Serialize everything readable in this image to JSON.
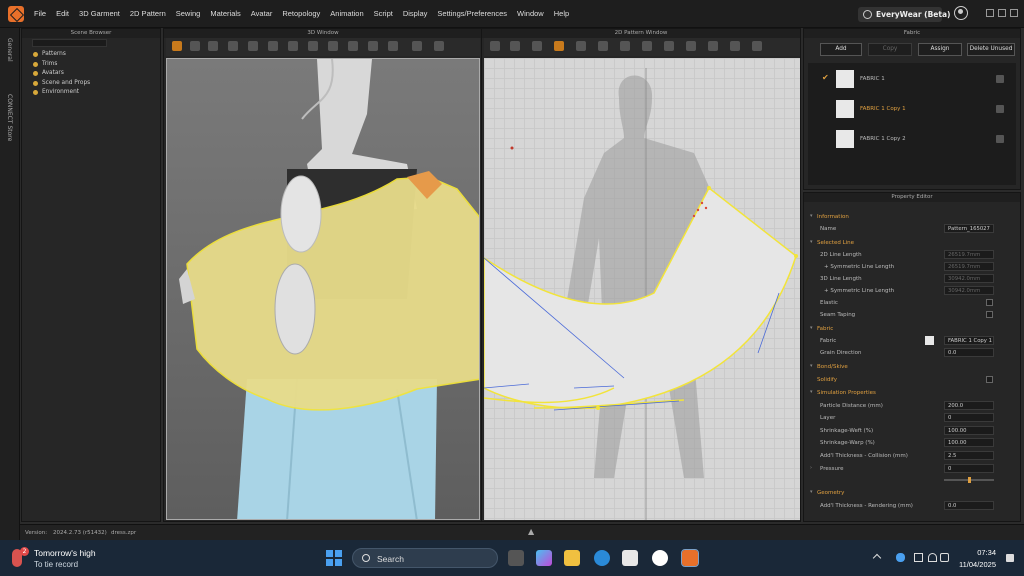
{
  "menubar": {
    "items": [
      "File",
      "Edit",
      "3D Garment",
      "2D Pattern",
      "Sewing",
      "Materials",
      "Avatar",
      "Retopology",
      "Animation",
      "Script",
      "Display",
      "Settings/Preferences",
      "Window",
      "Help"
    ],
    "brand": "EveryWear (Beta)"
  },
  "leftstrip": {
    "tabs": [
      "General",
      "CONNECT Store"
    ]
  },
  "scene_browser": {
    "title": "Scene Browser",
    "items": [
      "Patterns",
      "Trims",
      "Avatars",
      "Scene and Props",
      "Environment"
    ]
  },
  "window3d": {
    "title": "3D Window"
  },
  "window2d": {
    "title": "2D Pattern Window"
  },
  "fabric": {
    "title": "Fabric",
    "buttons": {
      "add": "Add",
      "copy": "Copy",
      "assign": "Assign",
      "delete_unused": "Delete Unused"
    },
    "items": [
      {
        "name": "FABRIC 1",
        "checked": true
      },
      {
        "name": "FABRIC 1 Copy 1",
        "selected": true
      },
      {
        "name": "FABRIC 1 Copy 2"
      }
    ]
  },
  "property_editor": {
    "title": "Property Editor",
    "information": "Information",
    "name_label": "Name",
    "name_value": "Pattern_165027",
    "selected_line": "Selected Line",
    "len2d_label": "2D Line Length",
    "len2d_value": "26519.7mm",
    "sym2d_label": "+ Symmetric Line Length",
    "sym2d_value": "26519.7mm",
    "len3d_label": "3D Line Length",
    "len3d_value": "30942.0mm",
    "sym3d_label": "+ Symmetric Line Length",
    "sym3d_value": "30942.0mm",
    "elastic": "Elastic",
    "seam_taping": "Seam Taping",
    "fabric_section": "Fabric",
    "fabric_label": "Fabric",
    "fabric_value": "FABRIC 1 Copy 1",
    "grain_label": "Grain Direction",
    "grain_value": "0.0",
    "bond_skive": "Bond/Skive",
    "solidify": "Solidify",
    "simulation": "Simulation Properties",
    "particle_label": "Particle Distance (mm)",
    "particle_value": "200.0",
    "layer_label": "Layer",
    "layer_value": "0",
    "weft_label": "Shrinkage-Weft (%)",
    "weft_value": "100.00",
    "warp_label": "Shrinkage-Warp (%)",
    "warp_value": "100.00",
    "collision_label": "Add'l Thickness - Collision (mm)",
    "collision_value": "2.5",
    "pressure_label": "Pressure",
    "pressure_value": "0",
    "geometry": "Geometry",
    "rendering_label": "Add'l Thickness - Rendering (mm)",
    "rendering_value": "0.0"
  },
  "statusbar": {
    "version_label": "Version:",
    "version_value": "2024.2.73 (r51432)",
    "file": "dress.zpr"
  },
  "taskbar": {
    "weather_title": "Tomorrow's high",
    "weather_sub": "To tie record",
    "weather_badge": "2",
    "search": "Search",
    "time": "07:34",
    "date": "11/04/2025"
  },
  "colors": {
    "accent": "#e0a040",
    "garment": "#e8dc8a",
    "selection": "#f2e43a",
    "taskbar": "#1a2838"
  }
}
